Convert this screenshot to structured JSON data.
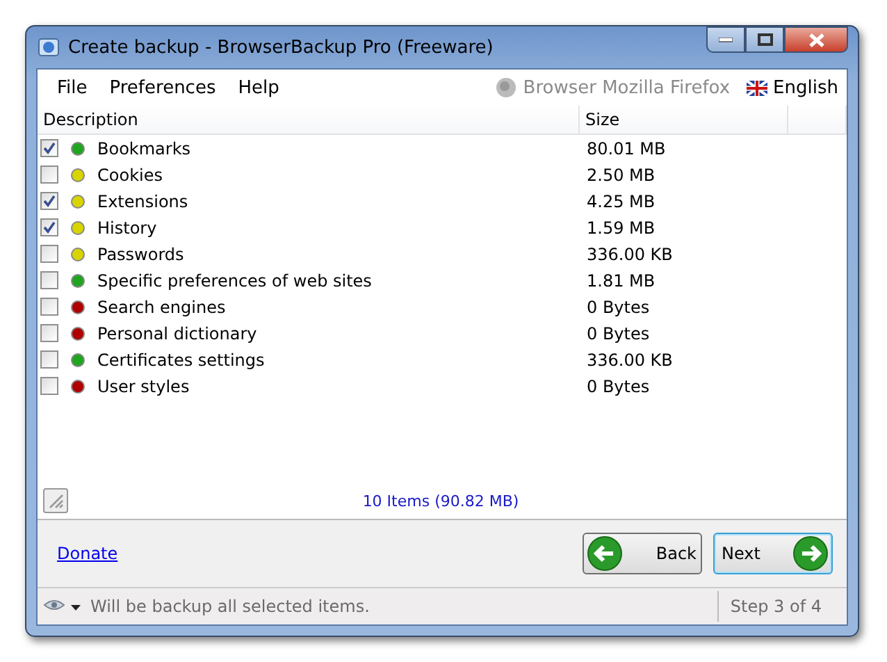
{
  "window": {
    "title": "Create backup - BrowserBackup Pro (Freeware)"
  },
  "menu": [
    "File",
    "Preferences",
    "Help"
  ],
  "browser": {
    "label": "Browser Mozilla Firefox",
    "disabled": true
  },
  "language": "English",
  "table": {
    "columns": [
      "Description",
      "Size"
    ],
    "rows": [
      {
        "label": "Bookmarks",
        "size": "80.01 MB",
        "checked": true,
        "color": "#1fa51f"
      },
      {
        "label": "Cookies",
        "size": "2.50 MB",
        "checked": false,
        "color": "#d8d400"
      },
      {
        "label": "Extensions",
        "size": "4.25 MB",
        "checked": true,
        "color": "#d8d400"
      },
      {
        "label": "History",
        "size": "1.59 MB",
        "checked": true,
        "color": "#d8d400"
      },
      {
        "label": "Passwords",
        "size": "336.00 KB",
        "checked": false,
        "color": "#d8d400"
      },
      {
        "label": "Specific preferences of web sites",
        "size": "1.81 MB",
        "checked": false,
        "color": "#1fa51f"
      },
      {
        "label": "Search engines",
        "size": "0 Bytes",
        "checked": false,
        "color": "#b00000"
      },
      {
        "label": "Personal dictionary",
        "size": "0 Bytes",
        "checked": false,
        "color": "#b00000"
      },
      {
        "label": "Certificates settings",
        "size": "336.00 KB",
        "checked": false,
        "color": "#1fa51f"
      },
      {
        "label": "User styles",
        "size": "0 Bytes",
        "checked": false,
        "color": "#b00000"
      }
    ]
  },
  "summary": "10 Items (90.82 MB)",
  "donate": "Donate",
  "buttons": [
    {
      "label": "Back",
      "kind": "back",
      "focused": false
    },
    {
      "label": "Next",
      "kind": "next",
      "focused": true
    }
  ],
  "status_bar": {
    "message": "Will be backup all selected items.",
    "step": "Step 3 of 4"
  }
}
